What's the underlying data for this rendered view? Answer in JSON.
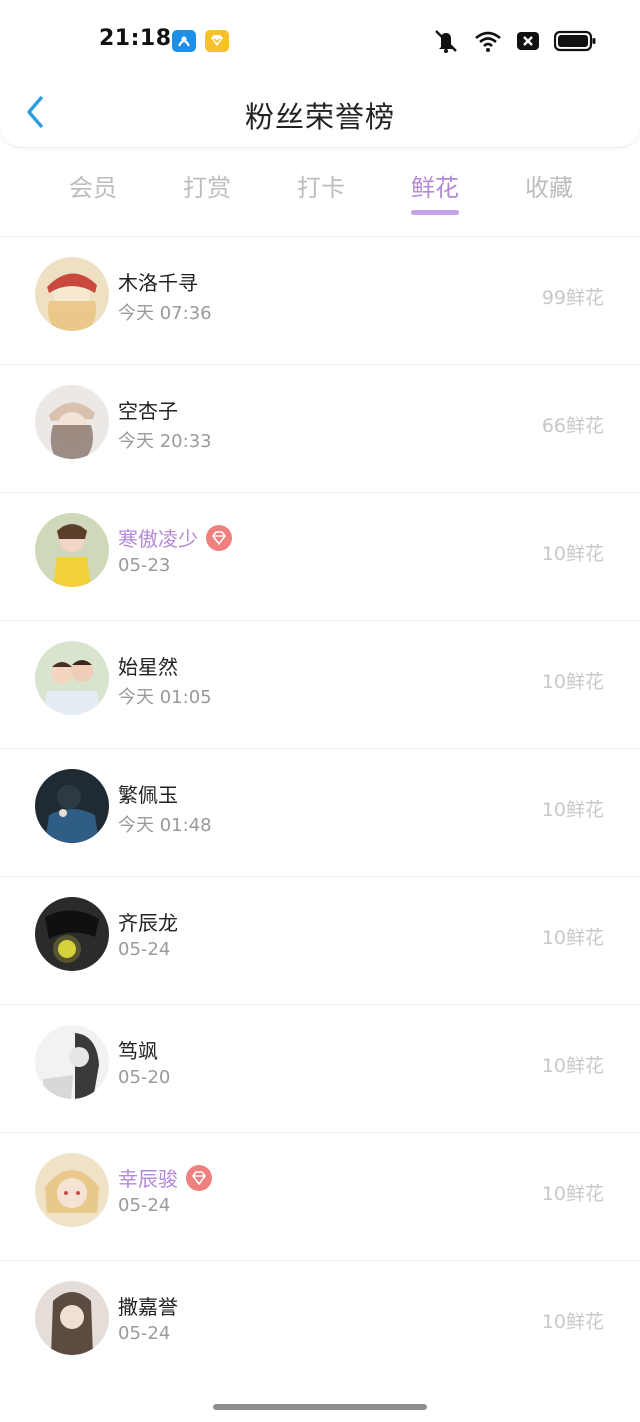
{
  "status": {
    "time": "21:18"
  },
  "header": {
    "title": "粉丝荣誉榜"
  },
  "tabs": [
    {
      "label": "会员",
      "active": false
    },
    {
      "label": "打赏",
      "active": false
    },
    {
      "label": "打卡",
      "active": false
    },
    {
      "label": "鲜花",
      "active": true
    },
    {
      "label": "收藏",
      "active": false
    }
  ],
  "colors": {
    "accent": "#b48ad8",
    "back_arrow": "#2a9fe0",
    "badge": "#f08080"
  },
  "fans": [
    {
      "name": "木洛千寻",
      "time": "今天 07:36",
      "flowers": "99鲜花",
      "vip": false
    },
    {
      "name": "空杏子",
      "time": "今天 20:33",
      "flowers": "66鲜花",
      "vip": false
    },
    {
      "name": "寒傲凌少",
      "time": "05-23",
      "flowers": "10鲜花",
      "vip": true
    },
    {
      "name": "始星然",
      "time": "今天 01:05",
      "flowers": "10鲜花",
      "vip": false
    },
    {
      "name": "繁佩玉",
      "time": "今天 01:48",
      "flowers": "10鲜花",
      "vip": false
    },
    {
      "name": "齐辰龙",
      "time": "05-24",
      "flowers": "10鲜花",
      "vip": false
    },
    {
      "name": "笃飒",
      "time": "05-20",
      "flowers": "10鲜花",
      "vip": false
    },
    {
      "name": "幸辰骏",
      "time": "05-24",
      "flowers": "10鲜花",
      "vip": true
    },
    {
      "name": "撒嘉誉",
      "time": "05-24",
      "flowers": "10鲜花",
      "vip": false
    }
  ]
}
